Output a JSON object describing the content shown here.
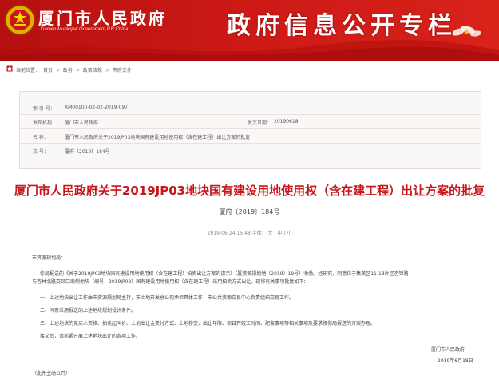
{
  "header": {
    "logo_title": "厦门市人民政府",
    "logo_subtitle": "Xiamen Municipal Government,P.R.China",
    "banner_title": "政府信息公开专栏"
  },
  "breadcrumb": {
    "prefix": "当前位置：",
    "items": [
      "首页",
      "政务",
      "政策法规",
      "市府文件"
    ],
    "separator": ">"
  },
  "info": {
    "index_label": "索 引 号：",
    "index_value": "XM00100-02-02-2019-097",
    "org_label": "发布机构：",
    "org_value": "厦门市人民政府",
    "date_label": "发文日期：",
    "date_value": "20190618",
    "name_label": "名    称：",
    "name_value": "厦门市人民政府关于2019JP03地块国有建设用地使用权（含在建工程）出让方案的批复",
    "docno_label": "文    号：",
    "docno_value": "厦府〔2019〕184号"
  },
  "document": {
    "title": "厦门市人民政府关于2019JP03地块国有建设用地使用权（含在建工程）出让方案的批复",
    "number": "厦府〔2019〕184号",
    "published": "2019-06-24 15:48",
    "font_label": "字体：",
    "font_large": "大",
    "font_medium": "中",
    "font_small": "小",
    "salutation": "市资源规划局：",
    "para1a": "你局报送的《关于2019JP03地块国有建设用地使用权（含在建工程）拍卖出让方案的请示》（厦资源规划地〔2019〕19号）收悉。经研究，同意位于集美区11-13片区杏锦路",
    "para1b": "与杏林北路交叉口南侧地块（编号：2019JP03）国有建设用地使用权（含在建工程）采用拍卖方式出让，现将有关事项批复如下：",
    "item1": "一、上述地块出让工作由市资源规划局主持，市土地开发总公司承担具体工作，市公共资源交易中心负责组织交易工作。",
    "item2": "二、同意采用报送的上述地块规划设计条件。",
    "item3": "三、上述地块的竞买人资格、拍卖起叫价、土地出让金支付方式、土地移交、出让年限、项目开竣工时间、配套事项等相关事项及要求按你局报送的方案办理。",
    "closing": "接文后，请抓紧开展上述地块出让的各项工作。",
    "sign_org": "厦门市人民政府",
    "sign_date": "2019年6月18日",
    "public_note": "（此件主动公开）"
  },
  "colors": {
    "banner_red": "#cf1b17",
    "title_red": "#c8161d"
  }
}
